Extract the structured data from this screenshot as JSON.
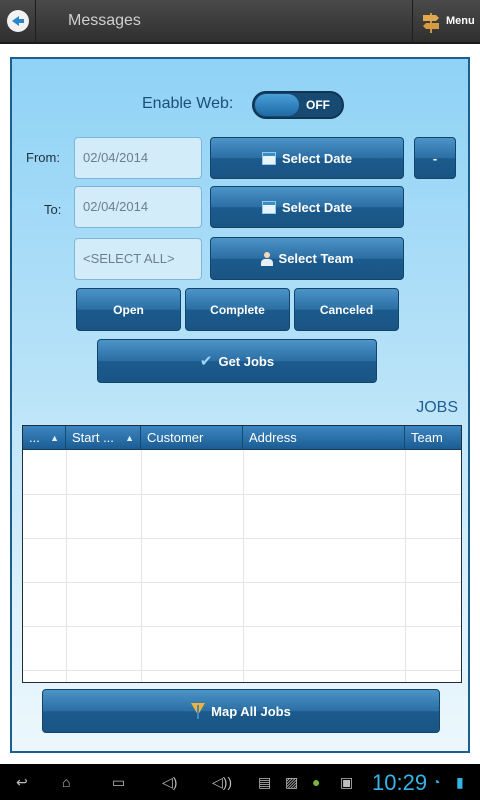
{
  "header": {
    "title": "Messages",
    "menu_label": "Menu"
  },
  "form": {
    "enable_web_label": "Enable Web:",
    "toggle_state": "OFF",
    "from_label": "From:",
    "from_date": "02/04/2014",
    "to_label": "To:",
    "to_date": "02/04/2014",
    "team_value": "<SELECT ALL>",
    "select_date_label": "Select Date",
    "minus_label": "-",
    "select_team_label": "Select Team",
    "status_buttons": [
      "Open",
      "Complete",
      "Canceled"
    ],
    "get_jobs_label": "Get Jobs"
  },
  "jobs": {
    "title": "JOBS",
    "columns": [
      "...",
      "Start ...",
      "Customer",
      "Address",
      "Team"
    ],
    "rows": []
  },
  "footer": {
    "map_all_label": "Map All Jobs"
  },
  "status": {
    "time": "10:29"
  },
  "colors": {
    "accent": "#1f5f93",
    "button": "#1c5b8e",
    "panel_top": "#8fd2f6",
    "clock": "#33b5e5"
  }
}
